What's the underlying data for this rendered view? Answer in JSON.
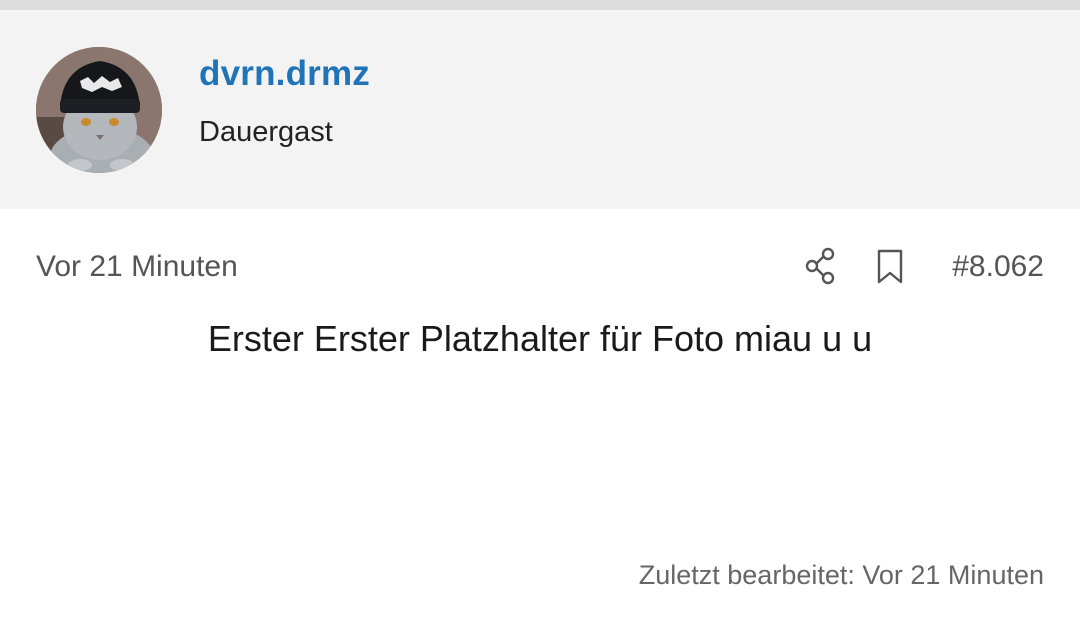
{
  "header": {
    "username": "dvrn.drmz",
    "user_title": "Dauergast",
    "avatar_icon": "cat-beanie-avatar"
  },
  "post": {
    "time": "Vor 21 Minuten",
    "share_icon": "share-icon",
    "bookmark_icon": "bookmark-icon",
    "number": "#8.062",
    "body": "Erster Erster Platzhalter für Foto miau u u",
    "last_edited": "Zuletzt bearbeitet: Vor 21 Minuten"
  },
  "colors": {
    "username": "#1f73b7",
    "header_bg": "#f3f3f3"
  }
}
